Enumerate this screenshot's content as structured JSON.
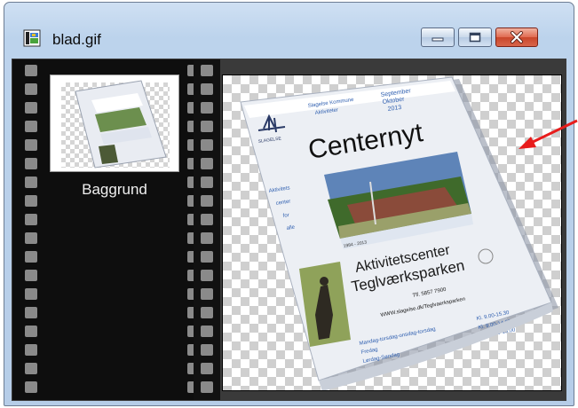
{
  "window": {
    "title": "blad.gif",
    "buttons": {
      "minimize": "minimize-icon",
      "maximize": "maximize-icon",
      "close": "close-icon"
    }
  },
  "layers": [
    {
      "label": "Baggrund",
      "selected": true
    }
  ],
  "document": {
    "header_left": "Slagelse Kommune",
    "header_left2": "Aktiviteter",
    "date_line1": "September",
    "date_line2": "Oktober",
    "date_line3": "2013",
    "logo_text": "SLAGELSE",
    "title": "Centernyt",
    "side_text": [
      "Aktivitets",
      "center",
      "for",
      "alle"
    ],
    "photo_caption": "1984 - 2013",
    "center_name_1": "Aktivitetscenter",
    "center_name_2": "Teglværksparken",
    "phone": "Tlf. 5857 7900",
    "web": "WWW.slagelse.dk/Teglvaerksparken",
    "hours": [
      {
        "days": "Mandag-torsdag-onsdag-torsdag",
        "time": "Kl. 9.00-15.30"
      },
      {
        "days": "Fredag",
        "time": "Kl. 9.00-14.00"
      },
      {
        "days": "Lørdag-Søndag",
        "time": "Kl. 11.00-15.00"
      }
    ]
  },
  "colors": {
    "annotation_arrow": "#e81c1c",
    "title_text": "#111111",
    "blue_text": "#2f5fb0"
  }
}
